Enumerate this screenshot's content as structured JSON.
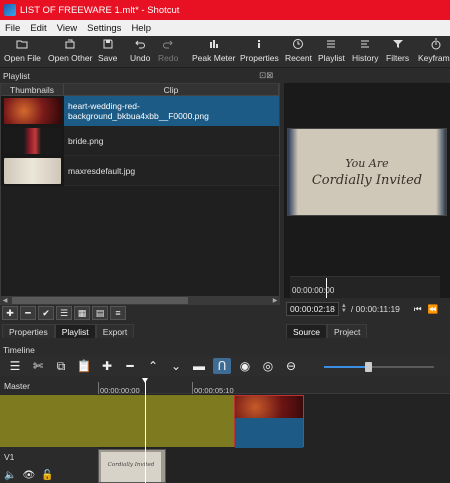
{
  "window": {
    "title": "LIST OF FREEWARE 1.mlt* - Shotcut"
  },
  "menu": [
    "File",
    "Edit",
    "View",
    "Settings",
    "Help"
  ],
  "toolbar": {
    "open_file": "Open File",
    "open_other": "Open Other",
    "save": "Save",
    "undo": "Undo",
    "redo": "Redo",
    "peak_meter": "Peak Meter",
    "properties": "Properties",
    "recent": "Recent",
    "playlist": "Playlist",
    "history": "History",
    "filters": "Filters",
    "keyframes": "Keyframe"
  },
  "playlist": {
    "panel_title": "Playlist",
    "columns": [
      "Thumbnails",
      "Clip"
    ],
    "rows": [
      {
        "clip": "heart-wedding-red-background_bkbua4xbb__F0000.png",
        "selected": true
      },
      {
        "clip": "bride.png",
        "selected": false
      },
      {
        "clip": "maxresdefault.jpg",
        "selected": false
      }
    ]
  },
  "left_tabs": [
    "Properties",
    "Playlist",
    "Export"
  ],
  "right_tabs": [
    "Source",
    "Project"
  ],
  "viewer": {
    "frame_text_line1": "You Are",
    "frame_text_line2": "Cordially Invited",
    "ruler_time": "00:00:00:00",
    "current_timecode": "00:00:02:18",
    "duration": "/ 00:00:11:19"
  },
  "timeline": {
    "panel_title": "Timeline",
    "ruler_ticks": [
      "00:00:00:00",
      "00:00:05:10"
    ],
    "tracks": [
      {
        "label": "Master"
      },
      {
        "label": "V1"
      }
    ],
    "v1_clip_text": "Cordially Invited"
  }
}
